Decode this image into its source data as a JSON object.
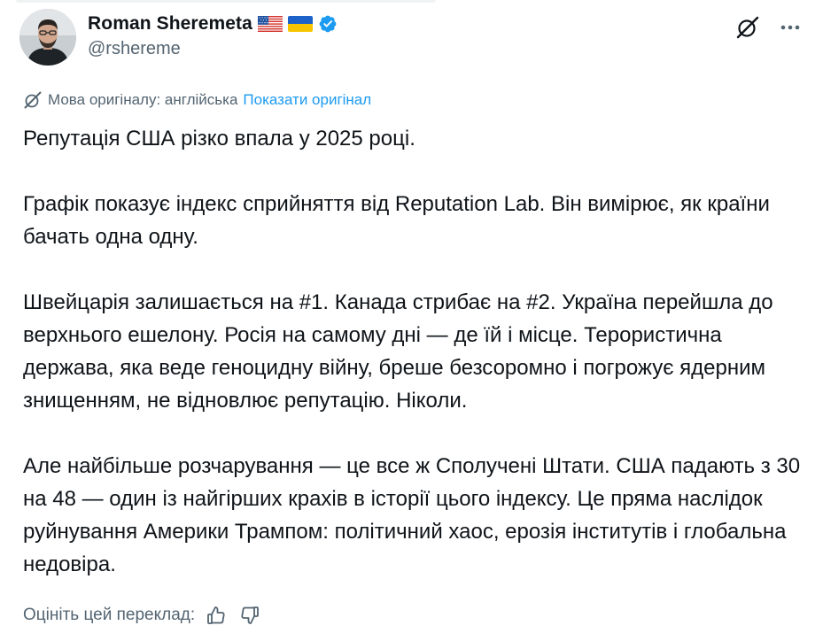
{
  "author": {
    "display_name": "Roman Sheremeta",
    "handle": "@rshereme",
    "flags": [
      "us-flag-icon",
      "ukraine-flag-icon"
    ],
    "verified": true
  },
  "translation": {
    "note": "Мова оригіналу: англійська",
    "show_original": "Показати оригінал"
  },
  "tweet": {
    "paragraphs": [
      "Репутація США різко впала у 2025 році.",
      "Графік показує індекс сприйняття від Reputation Lab. Він вимірює, як країни бачать одна одну.",
      "Швейцарія залишається на #1. Канада стрибає на #2. Україна перейшла до верхнього ешелону. Росія на самому дні — де їй і місце. Терористична держава, яка веде геноцидну війну, бреше безсоромно і погрожує ядерним знищенням, не відновлює репутацію. Ніколи.",
      "Але найбільше розчарування — це все ж Сполучені Штати. США падають з 30 на 48 — один із найгірших крахів в історії цього індексу. Це пряма наслідок руйнування Америки Трампом: політичний хаос, ерозія інститутів і глобальна недовіра."
    ]
  },
  "rating": {
    "label": "Оцініть цей переклад:"
  },
  "colors": {
    "text": "#0f1419",
    "muted": "#536471",
    "link": "#1d9bf0",
    "verified": "#1d9bf0"
  }
}
